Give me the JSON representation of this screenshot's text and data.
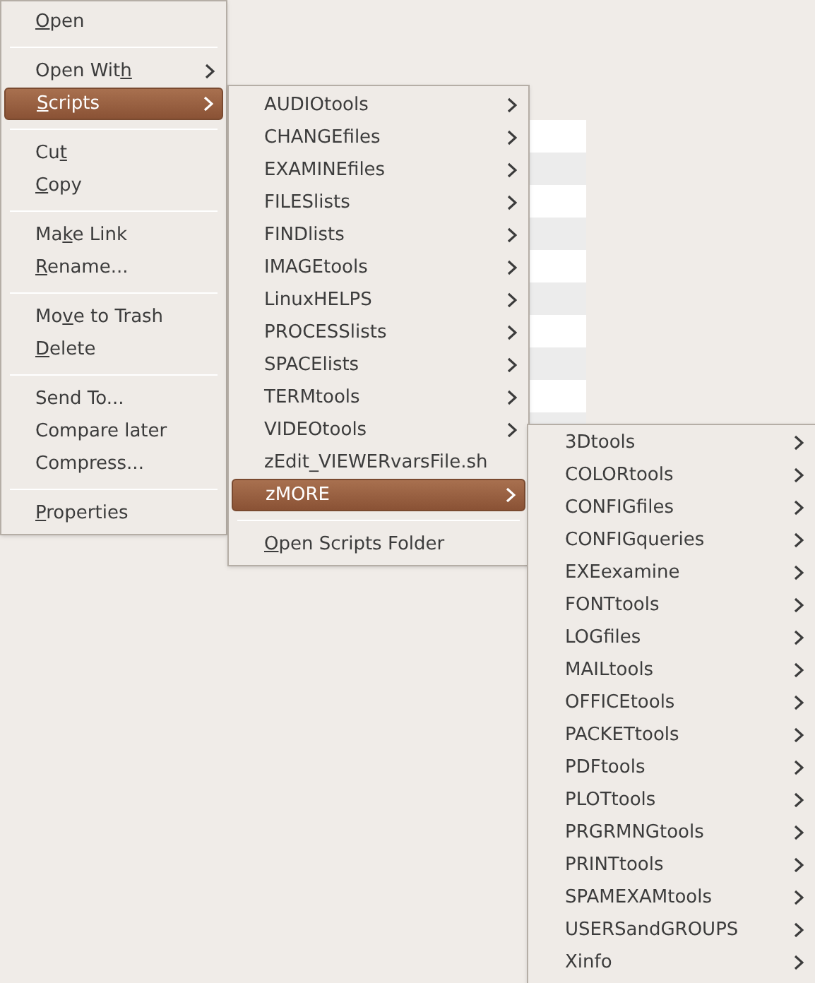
{
  "context_menu": {
    "items": [
      {
        "kind": "item",
        "key": "O",
        "post": "pen",
        "submenu": false,
        "selected": false
      },
      {
        "kind": "separator"
      },
      {
        "kind": "item",
        "pre": "Open Wit",
        "key": "h",
        "submenu": true,
        "selected": false
      },
      {
        "kind": "item",
        "key": "S",
        "post": "cripts",
        "submenu": true,
        "selected": true
      },
      {
        "kind": "separator"
      },
      {
        "kind": "item",
        "pre": "Cu",
        "key": "t",
        "submenu": false,
        "selected": false
      },
      {
        "kind": "item",
        "key": "C",
        "post": "opy",
        "submenu": false,
        "selected": false
      },
      {
        "kind": "separator"
      },
      {
        "kind": "item",
        "pre": "Ma",
        "key": "k",
        "post": "e Link",
        "submenu": false,
        "selected": false
      },
      {
        "kind": "item",
        "key": "R",
        "post": "ename...",
        "submenu": false,
        "selected": false
      },
      {
        "kind": "separator"
      },
      {
        "kind": "item",
        "pre": "Mo",
        "key": "v",
        "post": "e to Trash",
        "submenu": false,
        "selected": false
      },
      {
        "kind": "item",
        "key": "D",
        "post": "elete",
        "submenu": false,
        "selected": false
      },
      {
        "kind": "separator"
      },
      {
        "kind": "item",
        "pre": "Send To...",
        "submenu": false,
        "selected": false
      },
      {
        "kind": "item",
        "pre": "Compare later",
        "submenu": false,
        "selected": false
      },
      {
        "kind": "item",
        "pre": "Compress...",
        "submenu": false,
        "selected": false
      },
      {
        "kind": "separator"
      },
      {
        "kind": "item",
        "key": "P",
        "post": "roperties",
        "submenu": false,
        "selected": false
      }
    ]
  },
  "scripts_menu": {
    "items": [
      {
        "kind": "item",
        "pre": "AUDIOtools",
        "submenu": true,
        "selected": false
      },
      {
        "kind": "item",
        "pre": "CHANGEfiles",
        "submenu": true,
        "selected": false
      },
      {
        "kind": "item",
        "pre": "EXAMINEfiles",
        "submenu": true,
        "selected": false
      },
      {
        "kind": "item",
        "pre": "FILESlists",
        "submenu": true,
        "selected": false
      },
      {
        "kind": "item",
        "pre": "FINDlists",
        "submenu": true,
        "selected": false
      },
      {
        "kind": "item",
        "pre": "IMAGEtools",
        "submenu": true,
        "selected": false
      },
      {
        "kind": "item",
        "pre": "LinuxHELPS",
        "submenu": true,
        "selected": false
      },
      {
        "kind": "item",
        "pre": "PROCESSlists",
        "submenu": true,
        "selected": false
      },
      {
        "kind": "item",
        "pre": "SPACElists",
        "submenu": true,
        "selected": false
      },
      {
        "kind": "item",
        "pre": "TERMtools",
        "submenu": true,
        "selected": false
      },
      {
        "kind": "item",
        "pre": "VIDEOtools",
        "submenu": true,
        "selected": false
      },
      {
        "kind": "item",
        "pre": "zEdit_VIEWERvarsFile.sh",
        "submenu": false,
        "selected": false
      },
      {
        "kind": "item",
        "pre": "zMORE",
        "submenu": true,
        "selected": true
      },
      {
        "kind": "separator"
      },
      {
        "kind": "item",
        "key": "O",
        "post": "pen Scripts Folder",
        "submenu": false,
        "selected": false
      }
    ]
  },
  "zmore_menu": {
    "items": [
      {
        "kind": "item",
        "pre": "3Dtools",
        "submenu": true,
        "selected": false
      },
      {
        "kind": "item",
        "pre": "COLORtools",
        "submenu": true,
        "selected": false
      },
      {
        "kind": "item",
        "pre": "CONFIGfiles",
        "submenu": true,
        "selected": false
      },
      {
        "kind": "item",
        "pre": "CONFIGqueries",
        "submenu": true,
        "selected": false
      },
      {
        "kind": "item",
        "pre": "EXEexamine",
        "submenu": true,
        "selected": false
      },
      {
        "kind": "item",
        "pre": "FONTtools",
        "submenu": true,
        "selected": false
      },
      {
        "kind": "item",
        "pre": "LOGfiles",
        "submenu": true,
        "selected": false
      },
      {
        "kind": "item",
        "pre": "MAILtools",
        "submenu": true,
        "selected": false
      },
      {
        "kind": "item",
        "pre": "OFFICEtools",
        "submenu": true,
        "selected": false
      },
      {
        "kind": "item",
        "pre": "PACKETtools",
        "submenu": true,
        "selected": false
      },
      {
        "kind": "item",
        "pre": "PDFtools",
        "submenu": true,
        "selected": false
      },
      {
        "kind": "item",
        "pre": "PLOTtools",
        "submenu": true,
        "selected": false
      },
      {
        "kind": "item",
        "pre": "PRGRMNGtools",
        "submenu": true,
        "selected": false
      },
      {
        "kind": "item",
        "pre": "PRINTtools",
        "submenu": true,
        "selected": false
      },
      {
        "kind": "item",
        "pre": "SPAMEXAMtools",
        "submenu": true,
        "selected": false
      },
      {
        "kind": "item",
        "pre": "USERSandGROUPS",
        "submenu": true,
        "selected": false
      },
      {
        "kind": "item",
        "pre": "Xinfo",
        "submenu": true,
        "selected": false
      }
    ]
  }
}
